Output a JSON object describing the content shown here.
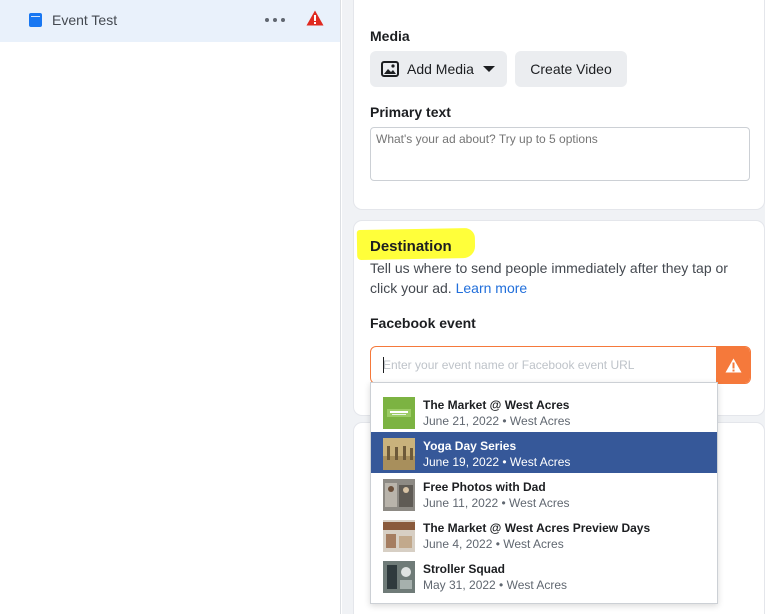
{
  "sidebar": {
    "ad_name": "Event Test",
    "icons": [
      "ad-icon",
      "more-icon",
      "warning-icon"
    ]
  },
  "media_section": {
    "label": "Media",
    "add_media_label": "Add Media",
    "create_video_label": "Create Video"
  },
  "primary_text": {
    "label": "Primary text",
    "placeholder": "What's your ad about? Try up to 5 options"
  },
  "destination": {
    "title": "Destination",
    "description": "Tell us where to send people immediately after they tap or click your ad.",
    "learn_more": "Learn more",
    "field_label": "Facebook event",
    "input_placeholder": "Enter your event name or Facebook event URL"
  },
  "events": [
    {
      "name": "The Market @ West Acres",
      "meta": "June 21, 2022 • West Acres",
      "selected": false
    },
    {
      "name": "Yoga Day Series",
      "meta": "June 19, 2022 • West Acres",
      "selected": true
    },
    {
      "name": "Free Photos with Dad",
      "meta": "June 11, 2022 • West Acres",
      "selected": false
    },
    {
      "name": "The Market @ West Acres Preview Days",
      "meta": "June 4, 2022 • West Acres",
      "selected": false
    },
    {
      "name": "Stroller Squad",
      "meta": "May 31, 2022 • West Acres",
      "selected": false
    }
  ],
  "colors": {
    "accent": "#1877f2",
    "warning": "#f5793b",
    "selected_row": "#365899",
    "highlight": "#ffff3a",
    "link": "#216fdb"
  }
}
